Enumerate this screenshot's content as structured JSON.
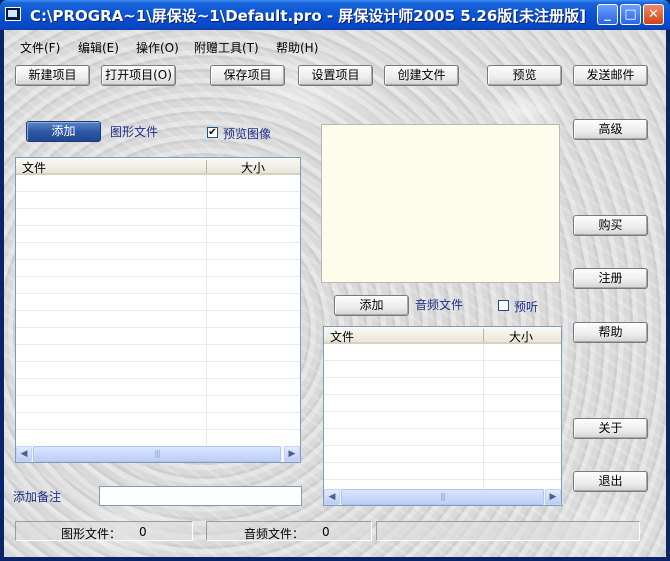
{
  "window": {
    "title": "C:\\PROGRA~1\\屏保设~1\\Default.pro - 屏保设计师2005 5.26版[未注册版]",
    "controls": {
      "minimize": "_",
      "maximize": "□",
      "close": "✕"
    }
  },
  "menu": [
    "文件(F)",
    "编辑(E)",
    "操作(O)",
    "附赠工具(T)",
    "帮助(H)"
  ],
  "toolbar": {
    "new_project": "新建项目",
    "open_project": "打开项目(O)",
    "save_project": "保存项目",
    "project_settings": "设置项目",
    "create_file": "创建文件",
    "preview": "预览",
    "send_email": "发送邮件"
  },
  "image_section": {
    "add_label": "添加",
    "title": "图形文件",
    "preview_checkbox_label": "预览图像",
    "preview_checked": true,
    "columns": [
      "文件",
      "大小"
    ],
    "rows": []
  },
  "audio_section": {
    "add_label": "添加",
    "title": "音频文件",
    "listen_checkbox_label": "预听",
    "listen_checked": false,
    "columns": [
      "文件",
      "大小"
    ],
    "rows": []
  },
  "side_buttons": {
    "advanced": "高级",
    "buy": "购买",
    "register": "注册",
    "help": "帮助",
    "about": "关于",
    "exit": "退出"
  },
  "notes": {
    "label": "添加备注",
    "value": ""
  },
  "status": {
    "image_label": "图形文件：",
    "image_count": "0",
    "audio_label": "音频文件：",
    "audio_count": "0"
  },
  "scroll_icons": {
    "left": "◀",
    "right": "▶"
  },
  "colors": {
    "titlebar": "#0a52d6",
    "accent_blue_button": "#2f5aa6",
    "label_blue": "#1a2f8a",
    "preview_bg": "#fefdeb"
  }
}
